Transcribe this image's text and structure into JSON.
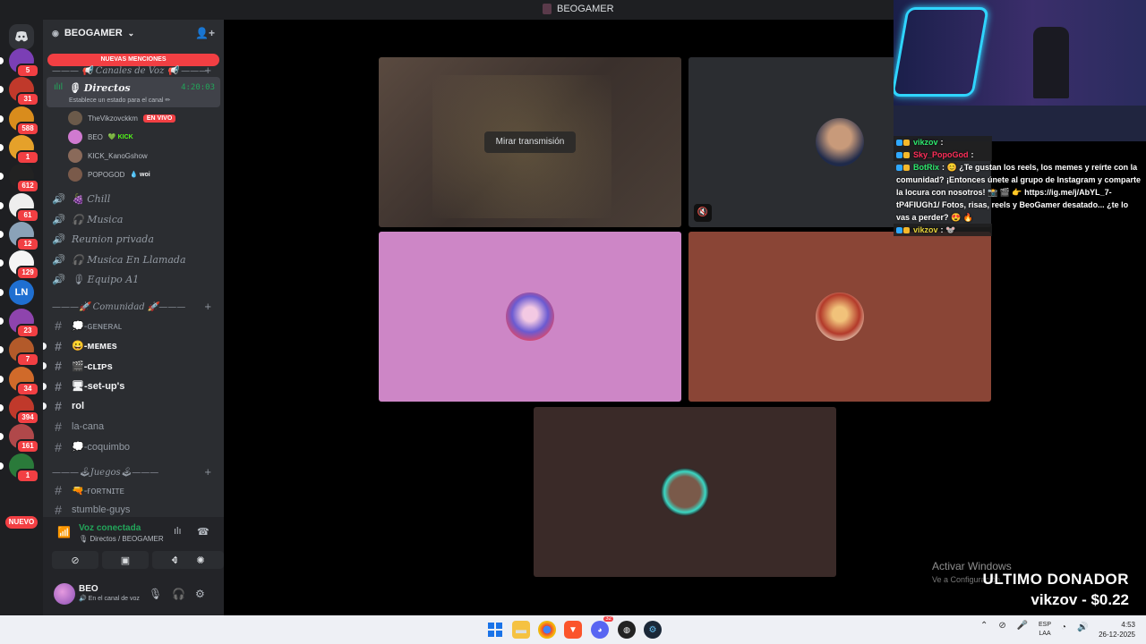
{
  "window": {
    "title": "BEOGAMER"
  },
  "server_rail": {
    "new_label": "NUEVO",
    "servers": [
      {
        "badge": "5",
        "color": "#7b3fb5"
      },
      {
        "badge": "31",
        "color": "#c0392b"
      },
      {
        "badge": "588",
        "color": "#d98c1c"
      },
      {
        "badge": "1",
        "color": "#e5a12a"
      },
      {
        "badge": "612",
        "color": "#222222"
      },
      {
        "badge": "61",
        "color": "#eeeeee"
      },
      {
        "badge": "12",
        "color": "#8aa2b8"
      },
      {
        "badge": "129",
        "color": "#f5f5f5"
      },
      {
        "badge": "",
        "color": "#1f6fd1",
        "text": "LN"
      },
      {
        "badge": "23",
        "color": "#8e44ad"
      },
      {
        "badge": "7",
        "color": "#b35a2a"
      },
      {
        "badge": "34",
        "color": "#d06a2a"
      },
      {
        "badge": "394",
        "color": "#c0392b"
      },
      {
        "badge": "161",
        "color": "#b0484a"
      },
      {
        "badge": "1",
        "color": "#2a7a3a"
      }
    ]
  },
  "sidebar": {
    "server_name": "BEOGAMER",
    "new_mentions": "NUEVAS MENCIONES",
    "voice_category": "——— 📢 Canales de Voz 📢 ———",
    "active_channel": {
      "name": "🎙 Directos",
      "time": "4:20:03",
      "status": "Establece un estado para el canal ✏"
    },
    "voice_users": [
      {
        "name": "TheVikzovckkm",
        "tag": "EN VIVO",
        "tag_type": "live",
        "color": "#6b5a4a"
      },
      {
        "name": "BEO",
        "tag": "💚 KICK",
        "tag_type": "kick",
        "color": "#d07ad0"
      },
      {
        "name": "KICK_KanoGshow",
        "tag": "",
        "tag_type": "",
        "color": "#8a6a5a"
      },
      {
        "name": "POPOGOD",
        "tag": "💧 woi",
        "tag_type": "woi",
        "color": "#7a5a4a"
      }
    ],
    "voice_channels": [
      "🍇 Chill",
      "🎧 Musica",
      "Reunion privada",
      "🎧 Musica En Llamada",
      "🎙 Equipo A1"
    ],
    "community_category": "———🚀 Comunidad 🚀———",
    "text_channels": [
      {
        "name": "💭-ɢᴇɴᴇʀᴀʟ",
        "bold": false,
        "unread": false
      },
      {
        "name": "😀-ᴍᴇᴍᴇs",
        "bold": true,
        "unread": true
      },
      {
        "name": "🎬-ᴄʟɪᴘs",
        "bold": true,
        "unread": true
      },
      {
        "name": "🖥-set-up's",
        "bold": true,
        "unread": true
      },
      {
        "name": "rol",
        "bold": true,
        "unread": true
      },
      {
        "name": "la-cana",
        "bold": false,
        "unread": false
      },
      {
        "name": "💭-coquimbo",
        "bold": false,
        "unread": false
      }
    ],
    "games_category": "———🕹Juegos🕹———",
    "game_channels": [
      {
        "name": "🔫-ғᴏʀᴛɴɪᴛᴇ",
        "bold": false
      },
      {
        "name": "stumble-guys",
        "bold": false
      }
    ]
  },
  "voice_panel": {
    "status": "Voz conectada",
    "location": "🎙 Directos / BEOGAMER"
  },
  "user_panel": {
    "username": "BEO",
    "status": "🔊 En el canal de voz"
  },
  "stage": {
    "watch_stream_label": "Mirar transmisión"
  },
  "chat": [
    {
      "user": "vikzov",
      "message": ":",
      "color": "#2ee86e",
      "bg": true
    },
    {
      "user": "Sky_PopoGod",
      "message": ":",
      "color": "#ff2f5a",
      "bg": true
    },
    {
      "user": "BotRix",
      "message": ": 😊 ¿Te gustan los reels, los memes y reírte con la comunidad? ¡Entonces únete al grupo de Instagram y comparte la locura con nosotros! 📸 🎬 👉 https://ig.me/j/AbYL_7-tP4FIUGh1/ Fotos, risas, reels y BeoGamer desatado... ¿te lo vas a perder? 😍 🔥",
      "color": "#2ee86e",
      "bg": false
    },
    {
      "user": "vikzov",
      "message": ": 🐭",
      "color": "#e5d23a",
      "bg": true
    }
  ],
  "overlay": {
    "activate_windows": "Activar Windows",
    "activate_sub": "Ve a Configuración",
    "donor_title": "ULTIMO DONADOR",
    "donor_line": "vikzov - $0.22"
  },
  "taskbar": {
    "lang_top": "ESP",
    "lang_bottom": "LAA",
    "time": "4:53",
    "date": "26-12-2025",
    "discord_badge": "32"
  }
}
